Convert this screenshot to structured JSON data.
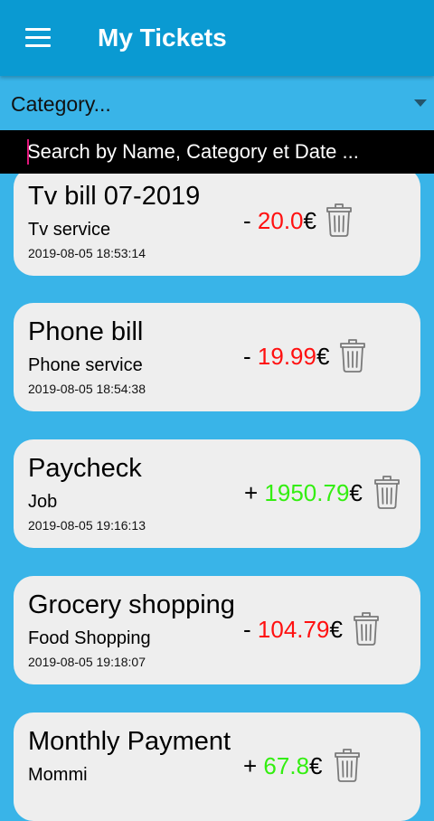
{
  "appbar": {
    "title": "My Tickets"
  },
  "filter": {
    "category_label": "Category..."
  },
  "search": {
    "placeholder": "Search by Name, Category et Date ..."
  },
  "tickets": [
    {
      "name": "Tv bill 07-2019",
      "category": "Tv service",
      "date": "2019-08-05 18:53:14",
      "sign": "-",
      "amount": "20.0",
      "currency": "€",
      "type": "negative"
    },
    {
      "name": "Phone bill",
      "category": "Phone service",
      "date": "2019-08-05 18:54:38",
      "sign": "-",
      "amount": "19.99",
      "currency": "€",
      "type": "negative"
    },
    {
      "name": "Paycheck",
      "category": "Job",
      "date": "2019-08-05 19:16:13",
      "sign": "+",
      "amount": "1950.79",
      "currency": "€",
      "type": "positive"
    },
    {
      "name": "Grocery shopping",
      "category": "Food Shopping",
      "date": "2019-08-05 19:18:07",
      "sign": "-",
      "amount": "104.79",
      "currency": "€",
      "type": "negative"
    },
    {
      "name": "Monthly Payment",
      "category": "Mommi",
      "date": "",
      "sign": "+",
      "amount": "67.8",
      "currency": "€",
      "type": "positive"
    }
  ],
  "colors": {
    "appbar": "#0a9ad2",
    "background": "#39b4e8",
    "negative": "#ff1010",
    "positive": "#33ee10"
  },
  "icons": {
    "menu": "menu-icon",
    "dropdown": "chevron-down-icon",
    "delete": "trash-icon"
  }
}
